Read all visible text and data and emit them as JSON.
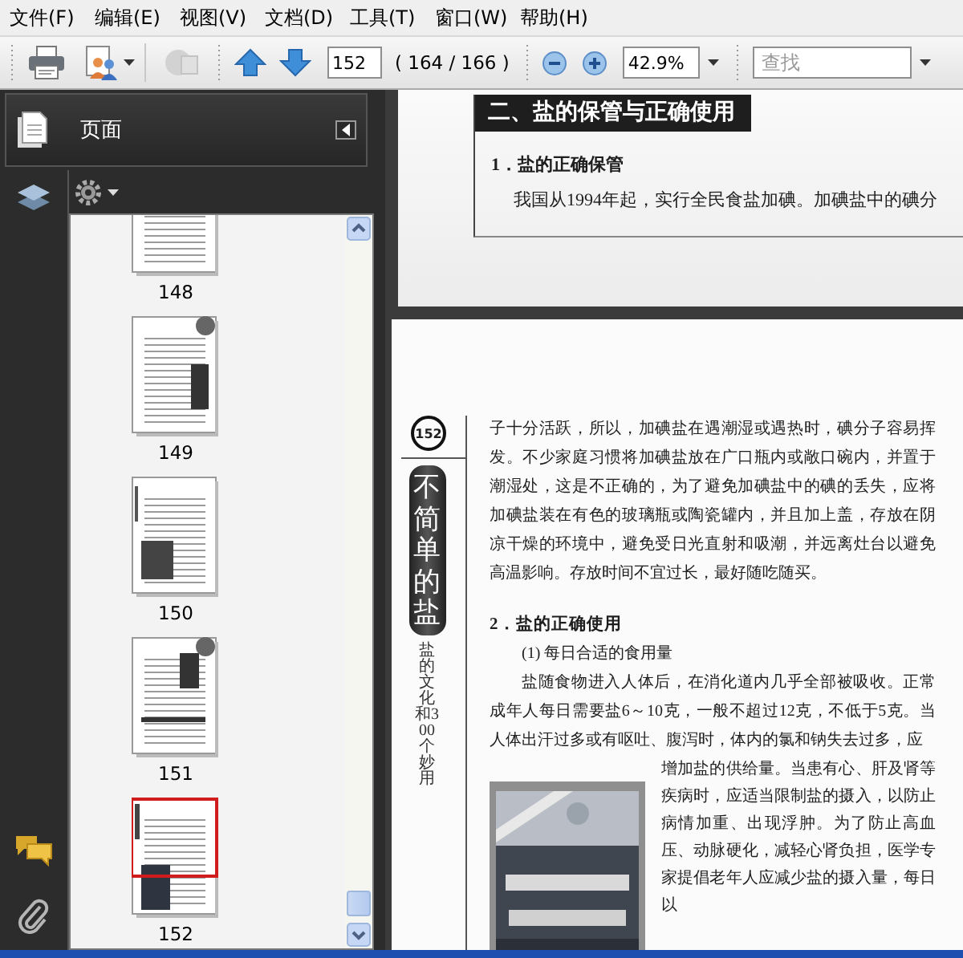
{
  "menu": [
    {
      "label": "文件(F)"
    },
    {
      "label": "编辑(E)"
    },
    {
      "label": "视图(V)"
    },
    {
      "label": "文档(D)"
    },
    {
      "label": "工具(T)"
    },
    {
      "label": "窗口(W)"
    },
    {
      "label": "帮助(H)"
    }
  ],
  "toolbar": {
    "page_number": "152",
    "page_count": "( 164 / 166 )",
    "zoom": "42.9%",
    "search": {
      "placeholder": "查找"
    }
  },
  "panel": {
    "title": "页面",
    "thumbnails": [
      {
        "label": "148",
        "selected": false
      },
      {
        "label": "149",
        "selected": false
      },
      {
        "label": "150",
        "selected": false
      },
      {
        "label": "151",
        "selected": false
      },
      {
        "label": "152",
        "selected": true
      }
    ]
  },
  "document": {
    "pages": [
      {
        "section_title": "二、盐的保管与正确使用",
        "subheading": "1．盐的正确保管",
        "paragraph": "我国从1994年起，实行全民食盐加碘。加碘盐中的碘分"
      },
      {
        "page_number": "152",
        "side_title": "不简单的盐",
        "side_subtitle": "盐的文化和300个妙用",
        "blocks": [
          {
            "kind": "paragraph",
            "indent": false,
            "text": "子十分活跃，所以，加碘盐在遇潮湿或遇热时，碘分子容易挥发。不少家庭习惯将加碘盐放在广口瓶内或敞口碗内，并置于潮湿处，这是不正确的，为了避免加碘盐中的碘的丢失，应将加碘盐装在有色的玻璃瓶或陶瓷罐内，并且加上盖，存放在阴凉干燥的环境中，避免受日光直射和吸潮，并远离灶台以避免高温影响。存放时间不宜过长，最好随吃随买。"
          },
          {
            "kind": "heading",
            "text": "2．盐的正确使用"
          },
          {
            "kind": "subheading",
            "text": "(1) 每日合适的食用量"
          },
          {
            "kind": "paragraph",
            "indent": true,
            "text": "盐随食物进入人体后，在消化道内几乎全部被吸收。正常成年人每日需要盐6～10克，一般不超过12克，不低于5克。当人体出汗过多或有呕吐、腹泻时，体内的氯和钠失去过多，应"
          },
          {
            "kind": "figure",
            "text": "增加盐的供给量。当患有心、肝及肾等疾病时，应适当限制盐的摄入，以防止病情加重、出现浮肿。为了防止高血压、动脉硬化，减轻心肾负担，医学专家提倡老年人应减少盐的摄入量，每日以"
          }
        ]
      }
    ]
  }
}
